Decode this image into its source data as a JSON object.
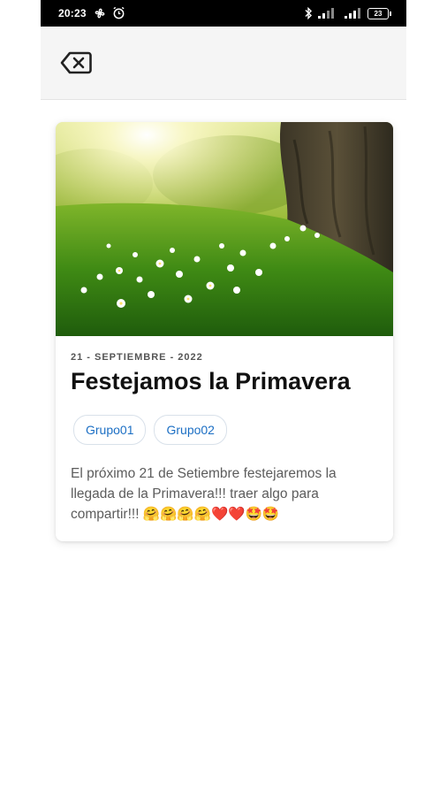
{
  "status_bar": {
    "time": "20:23",
    "battery": "23"
  },
  "icons": {
    "back": "backspace-icon",
    "bluetooth": "bluetooth-icon",
    "alarm": "alarm-icon",
    "signal": "signal-icon",
    "fan": "fan-icon"
  },
  "post": {
    "date": "21 - SEPTIEMBRE - 2022",
    "title": "Festejamos la Primavera",
    "groups": [
      "Grupo01",
      "Grupo02"
    ],
    "description": "El próximo 21 de Setiembre festejaremos la llegada de la Primavera!!! traer algo para compartir!!! 🤗🤗🤗🤗❤️❤️🤩🤩"
  },
  "colors": {
    "chip_text": "#1c6fc4",
    "appbar_bg": "#f5f5f5"
  }
}
